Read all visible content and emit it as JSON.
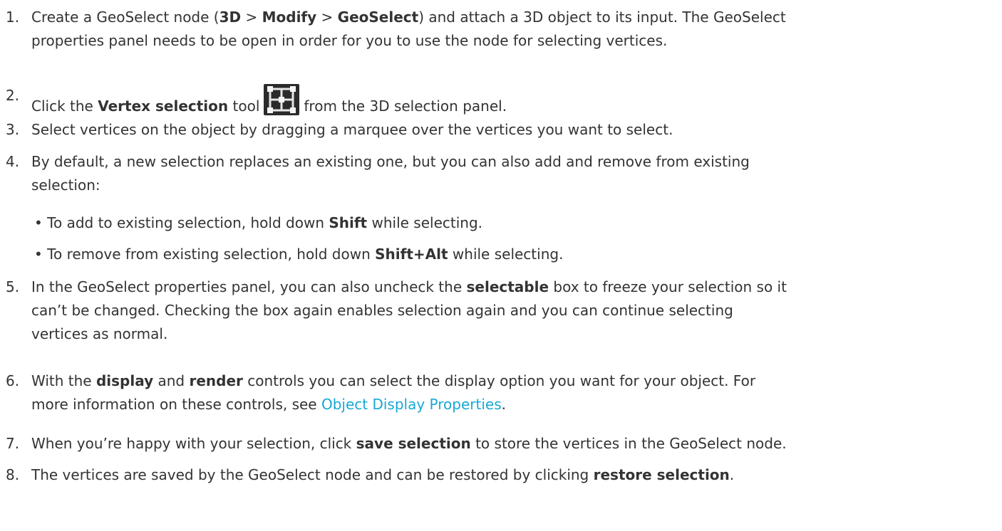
{
  "steps": [
    {
      "num": "1.",
      "pre": "Create a GeoSelect node (",
      "b1": "3D",
      "sep1": " > ",
      "b2": "Modify",
      "sep2": " > ",
      "b3": "GeoSelect",
      "post": ") and attach a 3D object to its input. The GeoSelect",
      "line2": "properties panel needs to be open in order for you to use the node for selecting vertices."
    },
    {
      "num": "2.",
      "pre": "Click the ",
      "bold": "Vertex selection",
      "mid": " tool",
      "icon": "vertex-selection-icon",
      "post": "from the 3D selection panel."
    },
    {
      "num": "3.",
      "text": "Select vertices on the object by dragging a marquee over the vertices you want to select."
    },
    {
      "num": "4.",
      "line1": "By default, a new selection replaces an existing one, but you can also add and remove from existing",
      "line2": "selection:",
      "bullet1_pre": "• To add to existing selection, hold down ",
      "bullet1_bold": "Shift",
      "bullet1_post": " while selecting.",
      "bullet2_pre": "• To remove from existing selection, hold down ",
      "bullet2_bold": "Shift+Alt",
      "bullet2_post": " while selecting."
    },
    {
      "num": "5.",
      "pre": "In the GeoSelect properties panel, you can also uncheck the ",
      "bold": "selectable",
      "post": " box to freeze your selection so it",
      "line2": "can’t be changed. Checking the box again enables selection again and you can continue selecting",
      "line3": "vertices as normal."
    },
    {
      "num": "6.",
      "pre": "With the ",
      "b1": "display",
      "mid": " and ",
      "b2": "render",
      "post": " controls you can select the display option you want for your object. For",
      "line2_pre": "more information on these controls, see ",
      "link": "Object Display Properties",
      "line2_post": "."
    },
    {
      "num": "7.",
      "pre": "When you’re happy with your selection, click ",
      "bold": "save selection",
      "post": " to store the vertices in the GeoSelect node."
    },
    {
      "num": "8.",
      "pre": "The vertices are saved by the GeoSelect node and can be restored by clicking ",
      "bold": "restore selection",
      "post": "."
    }
  ],
  "colors": {
    "text": "#333333",
    "link": "#17a8d6",
    "icon_bg": "#2b2b2b"
  }
}
